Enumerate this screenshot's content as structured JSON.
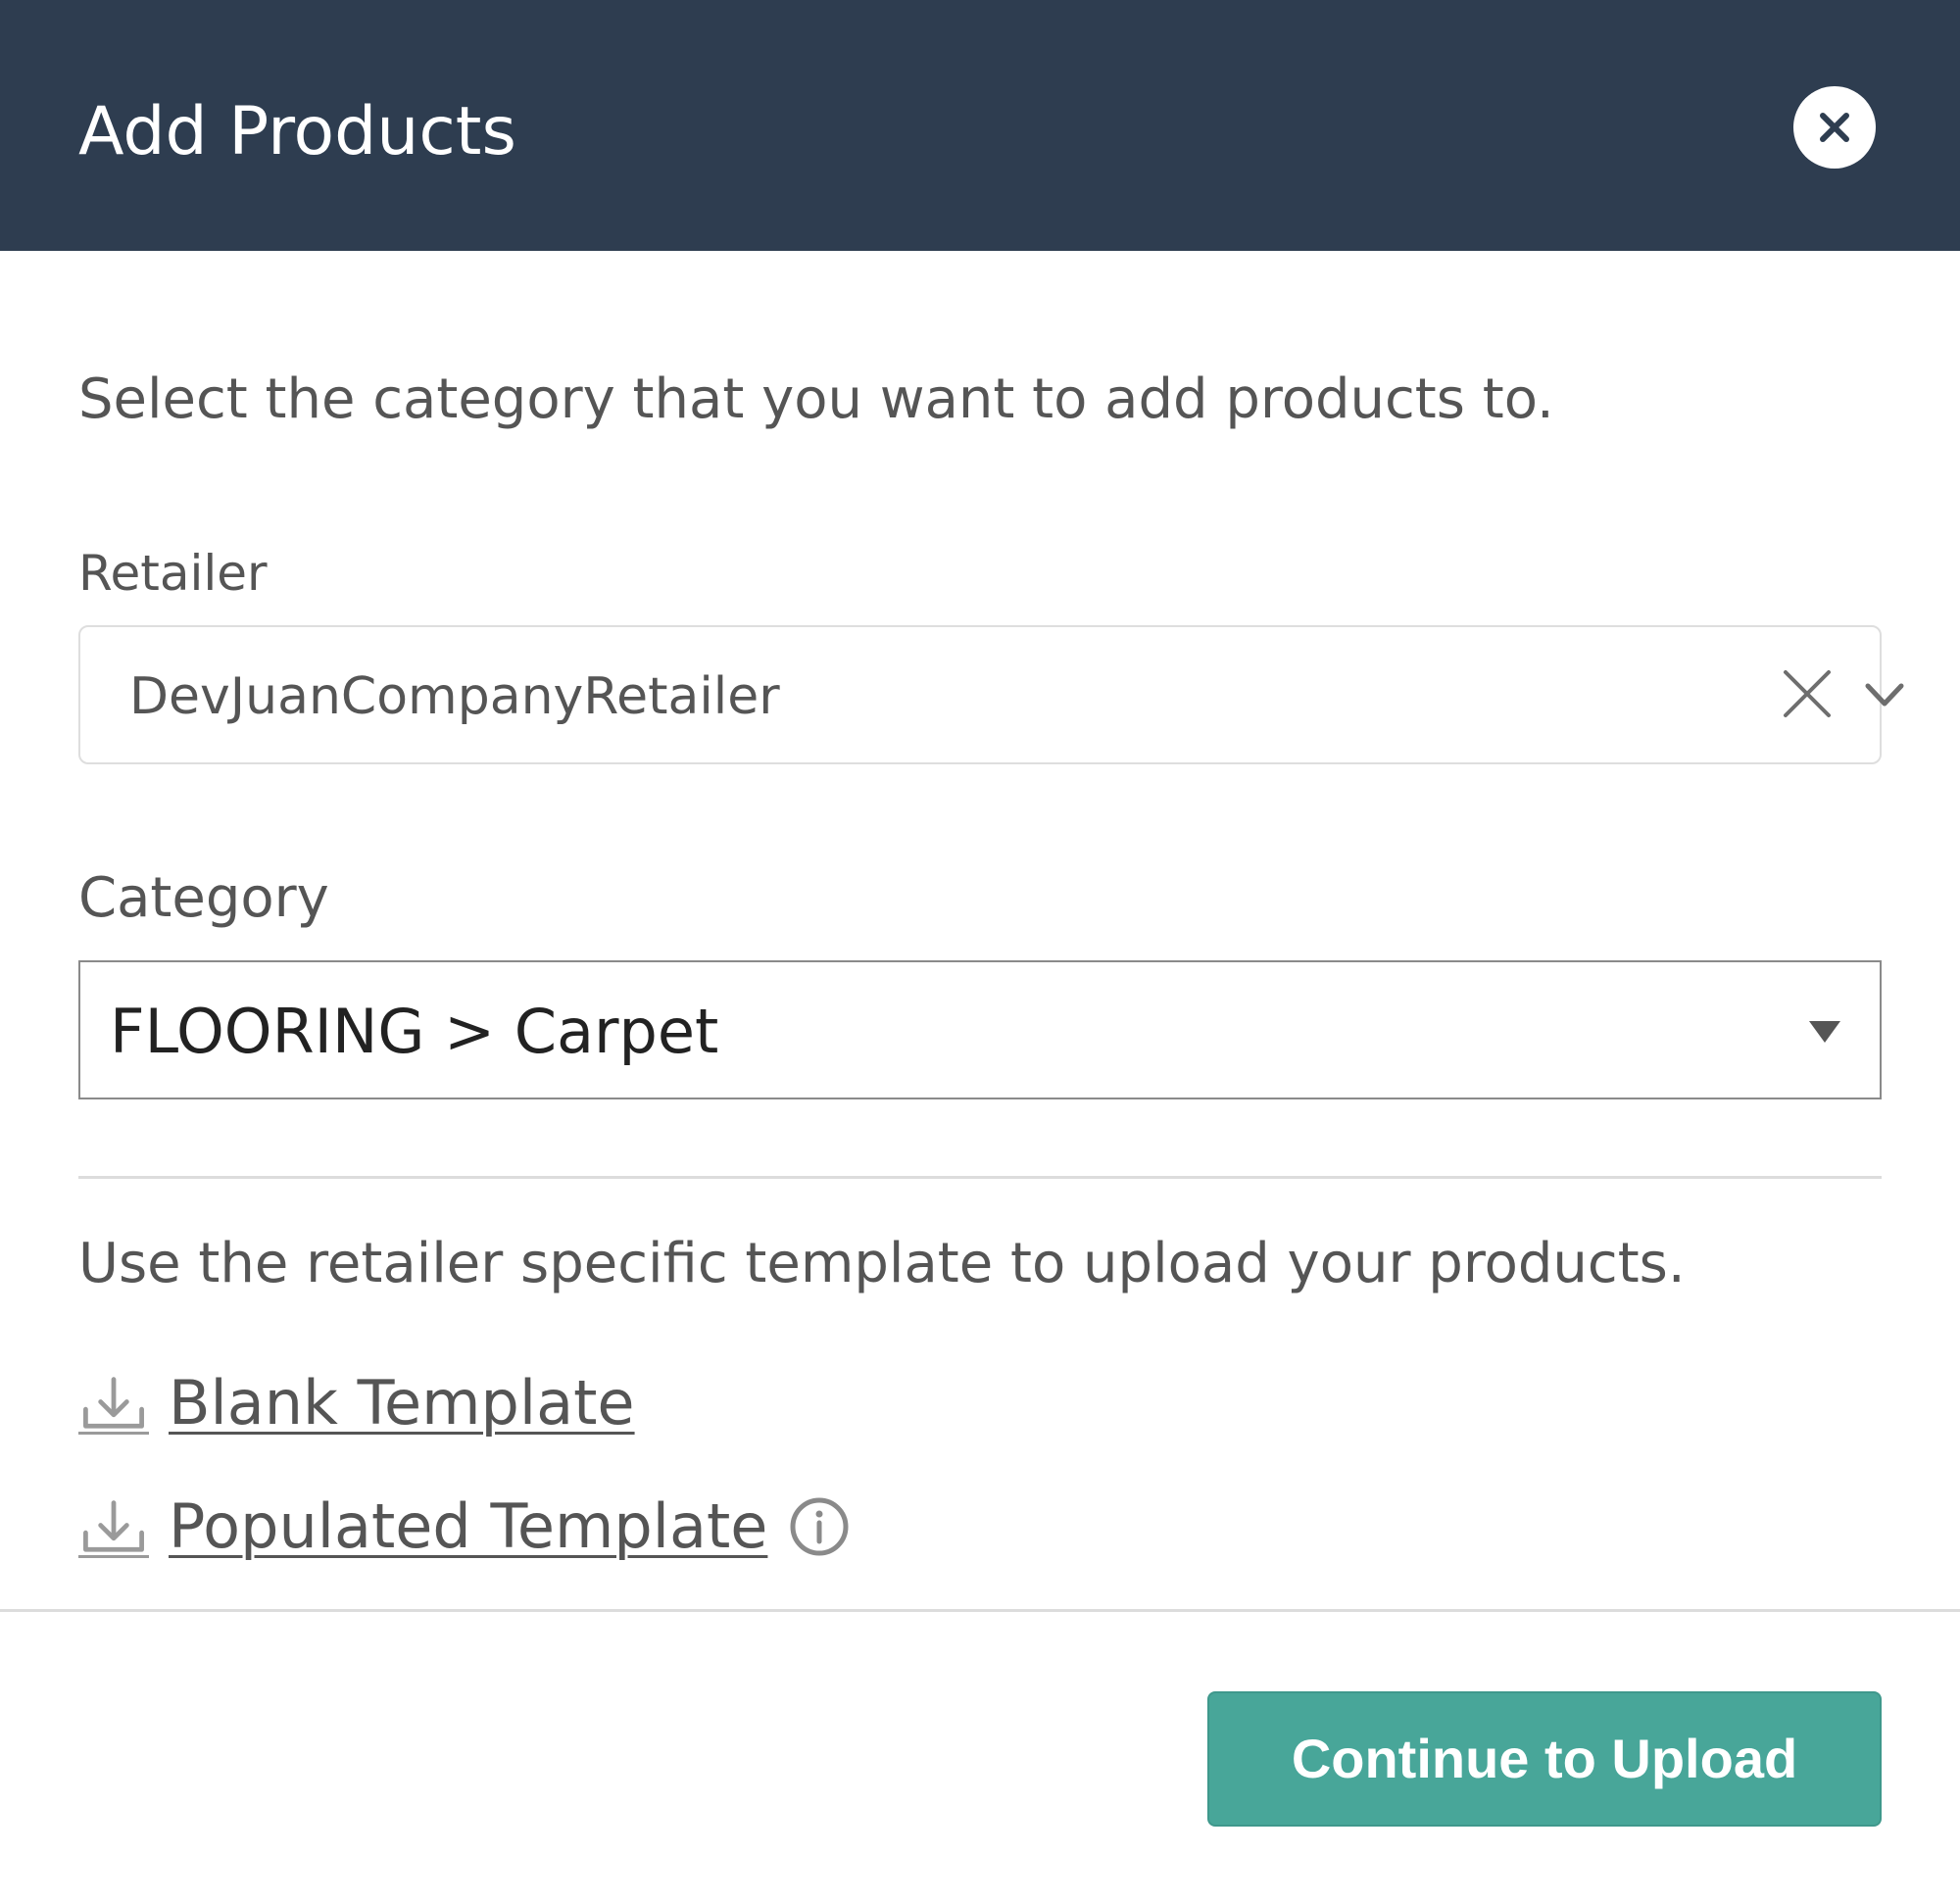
{
  "modal": {
    "title": "Add Products",
    "close_icon": "close-circle-icon"
  },
  "intro_text": "Select the category that you want to add products to.",
  "retailer": {
    "label": "Retailer",
    "value": "DevJuanCompanyRetailer",
    "clear_icon": "clear-x-icon",
    "dropdown_icon": "chevron-down-icon"
  },
  "category": {
    "label": "Category",
    "value": "FLOORING > Carpet",
    "dropdown_icon": "triangle-down-icon"
  },
  "templates": {
    "note": "Use the retailer specific template to upload your products.",
    "blank_label": "Blank Template",
    "populated_label": "Populated Template",
    "download_icon": "download-icon",
    "info_icon": "info-icon"
  },
  "footer": {
    "continue_label": "Continue to Upload"
  },
  "colors": {
    "header_bg": "#2e3d50",
    "primary_button": "#48a699",
    "text": "#555555"
  }
}
